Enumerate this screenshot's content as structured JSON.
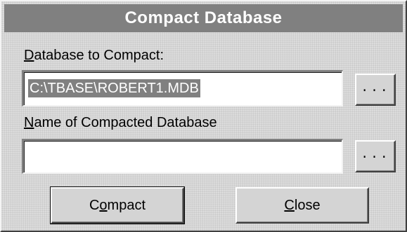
{
  "window": {
    "title": "Compact Database"
  },
  "source": {
    "label_mnemonic": "D",
    "label_rest": "atabase to Compact:",
    "value": "C:\\TBASE\\ROBERT1.MDB",
    "browse_label": "..."
  },
  "target": {
    "label_mnemonic": "N",
    "label_rest": "ame of Compacted Database",
    "value": "",
    "browse_label": "..."
  },
  "buttons": {
    "compact_pre": "C",
    "compact_mnemonic": "o",
    "compact_post": "mpact",
    "close_mnemonic": "C",
    "close_post": "lose"
  },
  "colors": {
    "titlebar": "#808080",
    "selection": "#808080",
    "face": "#d6d6d6"
  }
}
